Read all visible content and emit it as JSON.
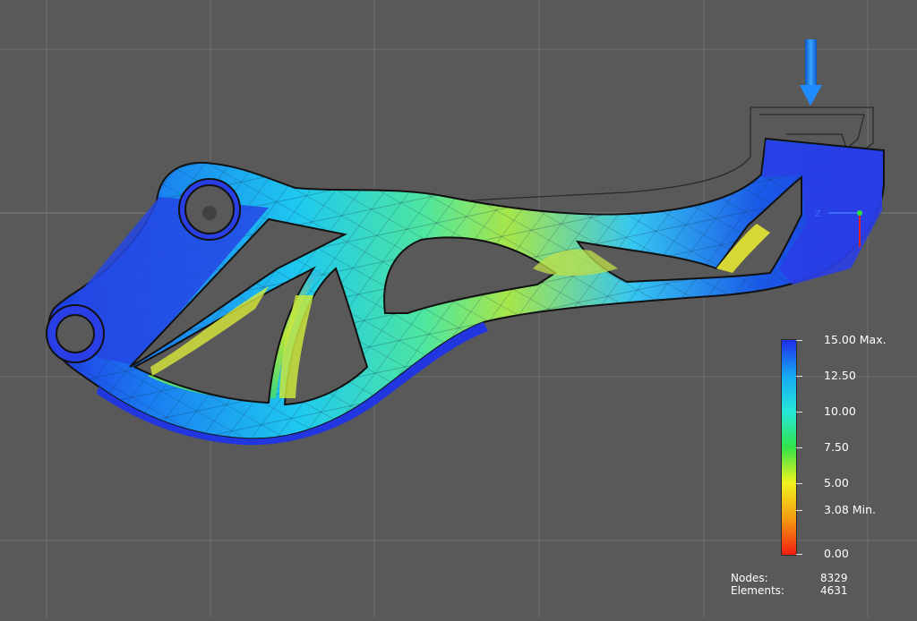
{
  "legend": {
    "max_label": "15.00 Max.",
    "t1": "12.50",
    "t2": "10.00",
    "t3": "7.50",
    "t4": "5.00",
    "min_label": "3.08 Min.",
    "zero_label": "0.00",
    "colors": [
      "#1f2de8",
      "#17a9f5",
      "#25e7d8",
      "#32e34a",
      "#f2f21f",
      "#f59a12",
      "#f01e10"
    ]
  },
  "stats": {
    "nodes_label": "Nodes:",
    "nodes_value": "8329",
    "elements_label": "Elements:",
    "elements_value": "4631"
  },
  "triad": {
    "z_label": "Z"
  },
  "colors": {
    "background": "#595959",
    "grid": "#707070",
    "load_arrow": "#1e8cff",
    "part_outline": "#111111"
  }
}
